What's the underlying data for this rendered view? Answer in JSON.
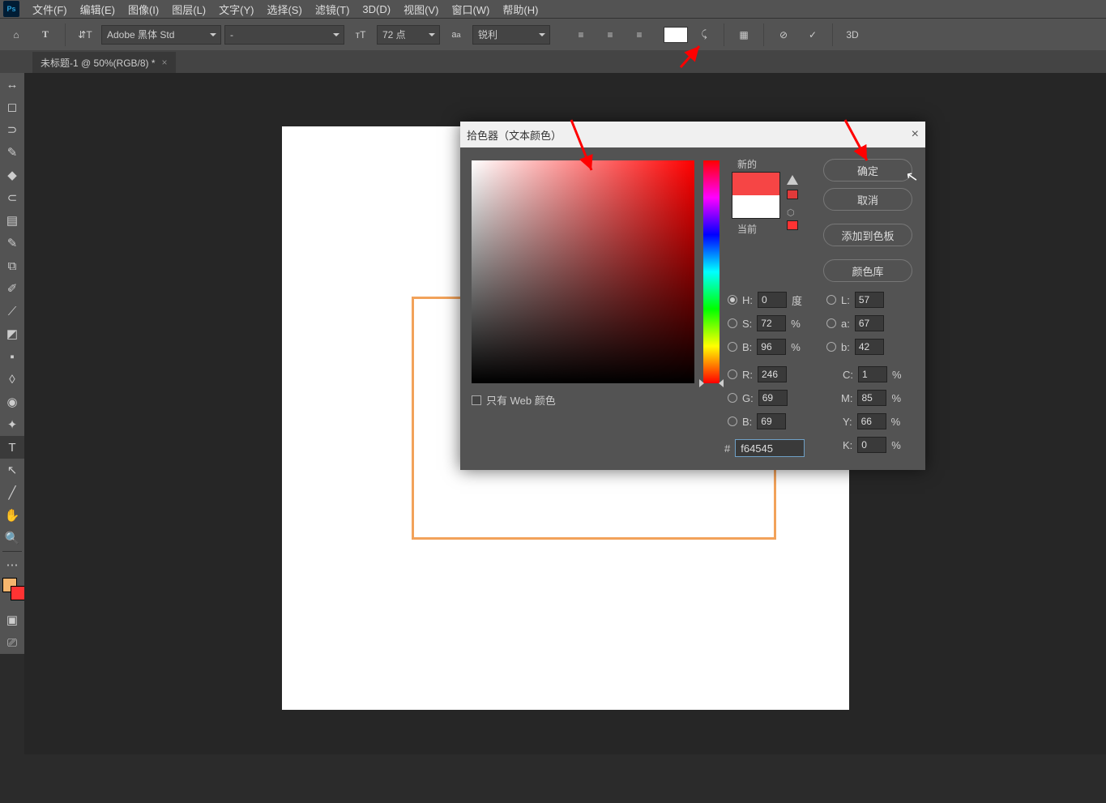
{
  "app": {
    "psIcon": "Ps"
  },
  "menu": [
    "文件(F)",
    "编辑(E)",
    "图像(I)",
    "图层(L)",
    "文字(Y)",
    "选择(S)",
    "滤镜(T)",
    "3D(D)",
    "视图(V)",
    "窗口(W)",
    "帮助(H)"
  ],
  "options": {
    "font": "Adobe 黑体 Std",
    "style": "-",
    "size": "72 点",
    "aa": "锐利",
    "threeD": "3D"
  },
  "tab": {
    "title": "未标题-1 @ 50%(RGB/8) *",
    "close": "×"
  },
  "tools": [
    "↔",
    "◻",
    "⊃",
    "✎",
    "◆",
    "⊂",
    "▤",
    "✎",
    "⧉",
    "✐",
    "⟋",
    "◩",
    "▪",
    "◊",
    "◉",
    "✦",
    "◯",
    "T",
    "↖",
    "╱",
    "✋",
    "🔍"
  ],
  "swatches": {
    "fg": "#f6b56e",
    "bg": "#ff3333"
  },
  "dialog": {
    "title": "拾色器（文本颜色）",
    "close": "×",
    "newLabel": "新的",
    "curLabel": "当前",
    "ok": "确定",
    "cancel": "取消",
    "addSwatch": "添加到色板",
    "colorLib": "颜色库",
    "webOnly": "只有 Web 颜色",
    "hashLabel": "#",
    "hex": "f64545",
    "hsb": {
      "H": {
        "l": "H:",
        "v": "0",
        "u": "度"
      },
      "S": {
        "l": "S:",
        "v": "72",
        "u": "%"
      },
      "B": {
        "l": "B:",
        "v": "96",
        "u": "%"
      }
    },
    "lab": {
      "L": {
        "l": "L:",
        "v": "57"
      },
      "a": {
        "l": "a:",
        "v": "67"
      },
      "b": {
        "l": "b:",
        "v": "42"
      }
    },
    "rgb": {
      "R": {
        "l": "R:",
        "v": "246"
      },
      "G": {
        "l": "G:",
        "v": "69"
      },
      "B": {
        "l": "B:",
        "v": "69"
      }
    },
    "cmyk": {
      "C": {
        "l": "C:",
        "v": "1",
        "u": "%"
      },
      "M": {
        "l": "M:",
        "v": "85",
        "u": "%"
      },
      "Y": {
        "l": "Y:",
        "v": "66",
        "u": "%"
      },
      "K": {
        "l": "K:",
        "v": "0",
        "u": "%"
      }
    }
  }
}
